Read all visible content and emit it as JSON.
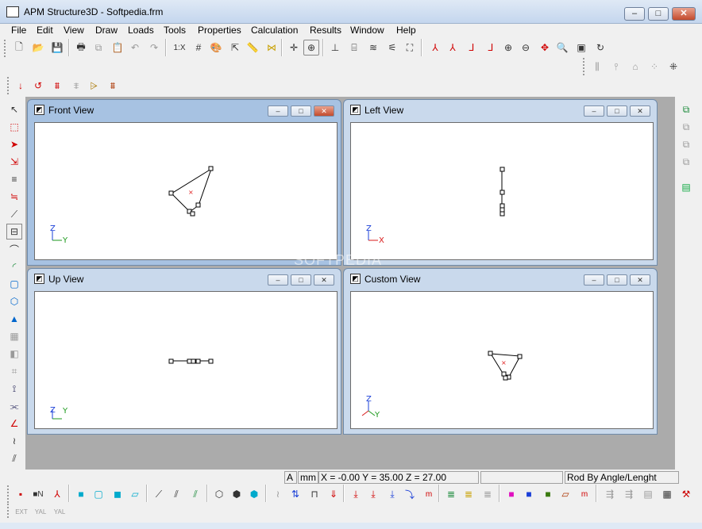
{
  "window": {
    "title": "APM Structure3D - Softpedia.frm"
  },
  "menu": [
    "File",
    "Edit",
    "View",
    "Draw",
    "Loads",
    "Tools",
    "Properties",
    "Calculation",
    "Results",
    "Window",
    "Help"
  ],
  "toolbar": {
    "scale_label": "1:X"
  },
  "views": [
    {
      "title": "Front View",
      "axis_up": "Z",
      "axis_right": "Y"
    },
    {
      "title": "Left View",
      "axis_up": "Z",
      "axis_right": "X"
    },
    {
      "title": "Up View",
      "axis_up": "Z",
      "axis_right": "Y"
    },
    {
      "title": "Custom View",
      "axis_up": "Z",
      "axis_right": "Y"
    }
  ],
  "watermark": "SOFTPEDIA",
  "status": {
    "mode": "A",
    "units": "mm",
    "coords": "X = -0.00 Y = 35.00 Z = 27.00",
    "hint": "Rod By Angle/Lenght"
  },
  "bottom_labels": {
    "ext": "EXT",
    "yal1": "YAL",
    "yal2": "YAL"
  },
  "colors": {
    "title_bar": "#c4d6ee",
    "mdi_background": "#ababab",
    "node_marker": "#e02020",
    "axis_z": "#1a3fd8",
    "axis_y": "#1d9a1d",
    "axis_x": "#d81a1a"
  }
}
